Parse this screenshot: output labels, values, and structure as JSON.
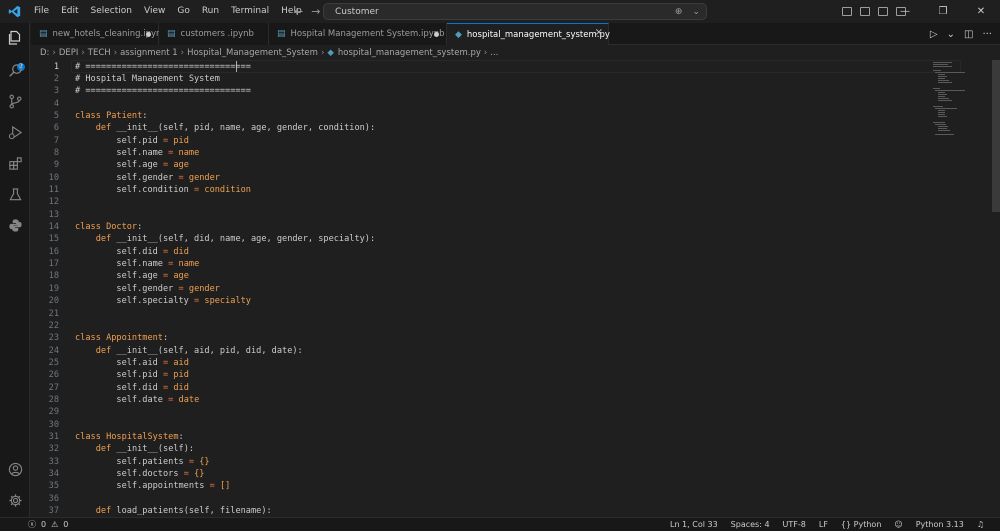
{
  "menu": [
    "File",
    "Edit",
    "Selection",
    "View",
    "Go",
    "Run",
    "Terminal",
    "Help"
  ],
  "command_center": {
    "text": "Customer"
  },
  "explorer_badge": "2",
  "tabs": [
    {
      "label": "new_hotels_cleaning.ipynb",
      "modified": true
    },
    {
      "label": "customers .ipynb",
      "modified": false
    },
    {
      "label": "Hospital Management System.ipynb",
      "modified": true
    },
    {
      "label": "hospital_management_system.py",
      "active": true
    }
  ],
  "breadcrumb": [
    "D:",
    "DEPI",
    "TECH",
    "assignment 1",
    "Hospital_Management_System",
    "hospital_management_system.py",
    "..."
  ],
  "code_lines": [
    "# ================================",
    "# Hospital Management System",
    "# ================================",
    "",
    "class Patient:",
    "    def __init__(self, pid, name, age, gender, condition):",
    "        self.pid = pid",
    "        self.name = name",
    "        self.age = age",
    "        self.gender = gender",
    "        self.condition = condition",
    "",
    "",
    "class Doctor:",
    "    def __init__(self, did, name, age, gender, specialty):",
    "        self.did = did",
    "        self.name = name",
    "        self.age = age",
    "        self.gender = gender",
    "        self.specialty = specialty",
    "",
    "",
    "class Appointment:",
    "    def __init__(self, aid, pid, did, date):",
    "        self.aid = aid",
    "        self.pid = pid",
    "        self.did = did",
    "        self.date = date",
    "",
    "",
    "class HospitalSystem:",
    "    def __init__(self):",
    "        self.patients = {}",
    "        self.doctors = {}",
    "        self.appointments = []",
    "",
    "    def load_patients(self, filename):"
  ],
  "status": {
    "errors": "0",
    "warnings": "0",
    "position": "Ln 1, Col 33",
    "spaces": "Spaces: 4",
    "encoding": "UTF-8",
    "eol": "LF",
    "language": "Python",
    "interpreter": "Python 3.13"
  },
  "colors": {
    "accent": "#0078d4",
    "keyword": "#f0a050",
    "operator": "#e8753d",
    "background": "#1f1f1f"
  },
  "icons": [
    "vscode-logo-icon",
    "explorer-icon",
    "search-icon",
    "source-control-icon",
    "run-debug-icon",
    "extensions-icon",
    "testing-icon",
    "python-icon",
    "account-icon",
    "settings-gear-icon"
  ]
}
